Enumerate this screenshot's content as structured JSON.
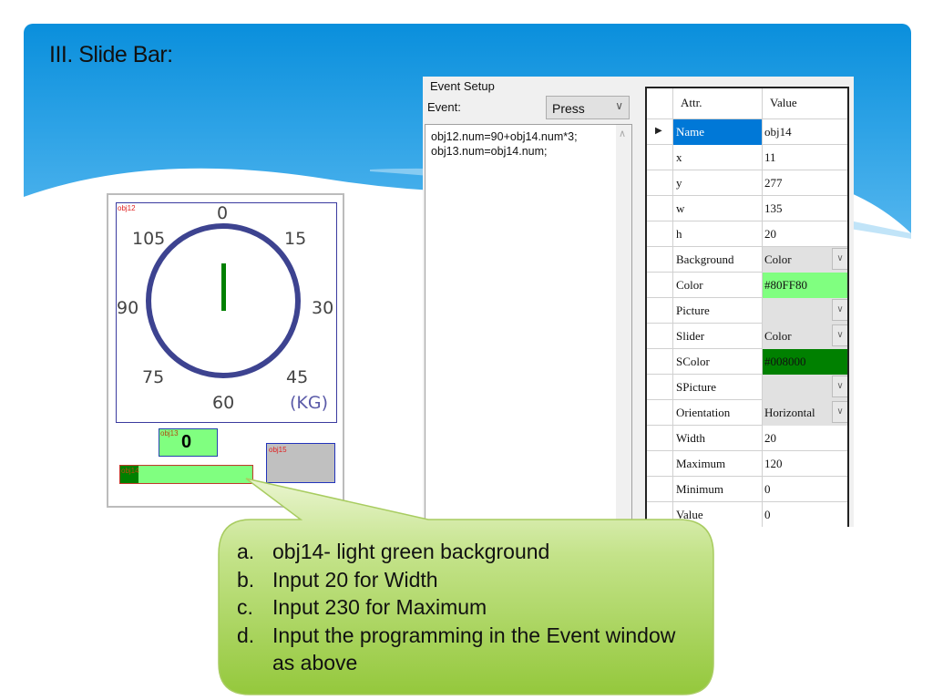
{
  "slide": {
    "title": "III. Slide Bar:",
    "colors": {
      "header_blue": "#0a8fdc",
      "callout_green": "#9ccd4a"
    }
  },
  "event_setup": {
    "group_title": "Event Setup",
    "event_label": "Event:",
    "event_selected": "Press",
    "code_lines": [
      "obj12.num=90+obj14.num*3;",
      "obj13.num=obj14.num;"
    ]
  },
  "property_grid": {
    "headers": {
      "attr": "Attr.",
      "value": "Value"
    },
    "rows": [
      {
        "attr": "Name",
        "value": "obj14",
        "selected": true
      },
      {
        "attr": "x",
        "value": "11"
      },
      {
        "attr": "y",
        "value": "277"
      },
      {
        "attr": "w",
        "value": "135"
      },
      {
        "attr": "h",
        "value": "20"
      },
      {
        "attr": "Background",
        "value": "Color",
        "type": "combo"
      },
      {
        "attr": "Color",
        "value": "#80FF80",
        "type": "swatch",
        "color": "#80ff80"
      },
      {
        "attr": "Picture",
        "value": "",
        "type": "combo"
      },
      {
        "attr": "Slider",
        "value": "Color",
        "type": "combo"
      },
      {
        "attr": "SColor",
        "value": "#008000",
        "type": "swatch",
        "color": "#008000"
      },
      {
        "attr": "SPicture",
        "value": "",
        "type": "combo"
      },
      {
        "attr": "Orientation",
        "value": "Horizontal",
        "type": "combo"
      },
      {
        "attr": "Width",
        "value": "20"
      },
      {
        "attr": "Maximum",
        "value": "120"
      },
      {
        "attr": "Minimum",
        "value": "0"
      },
      {
        "attr": "Value",
        "value": "0"
      }
    ]
  },
  "preview": {
    "obj12": {
      "tag": "obj12",
      "labels": [
        "0",
        "15",
        "30",
        "45",
        "60",
        "75",
        "90",
        "105"
      ],
      "unit": "(KG)",
      "needle_value": 0,
      "needle_color": "#008000",
      "ring_color": "#3d4390"
    },
    "obj13": {
      "tag": "obj13",
      "value": "0",
      "bg": "#80ff80"
    },
    "obj14": {
      "tag": "obj14",
      "value_fraction": 0,
      "bg": "#80ff80",
      "slider_color": "#008000"
    },
    "obj15": {
      "tag": "obj15",
      "bg": "#c0c0c0"
    }
  },
  "callout": {
    "items": [
      {
        "marker": "a.",
        "text": "obj14- light green background"
      },
      {
        "marker": "b.",
        "text": "Input 20 for Width"
      },
      {
        "marker": "c.",
        "text": "Input 230 for Maximum"
      },
      {
        "marker": "d.",
        "text": "Input the programming in the Event window as above"
      }
    ]
  }
}
